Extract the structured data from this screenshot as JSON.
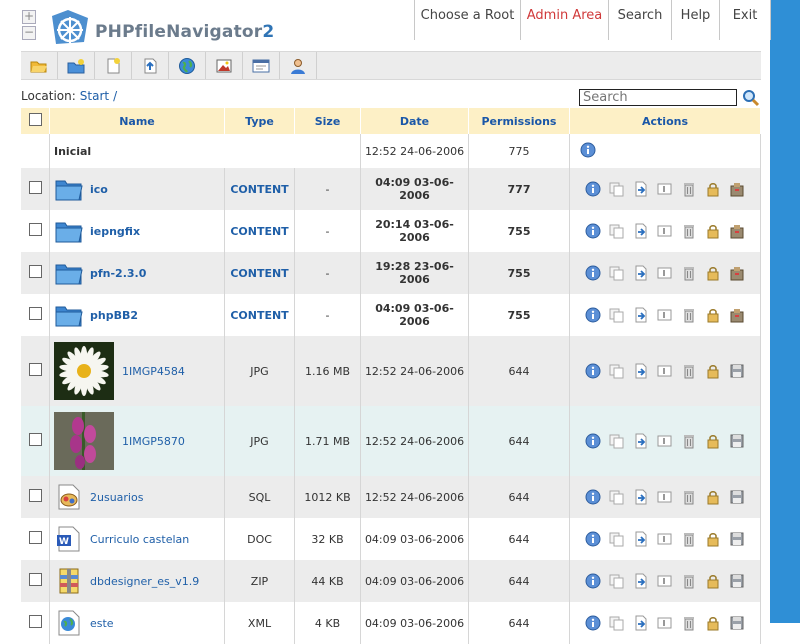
{
  "app": {
    "logo_text": "PHPfileNavigator",
    "logo_suffix": "2",
    "zoom_plus": "+",
    "zoom_minus": "−"
  },
  "nav": [
    {
      "label": "Choose a Root",
      "active": false
    },
    {
      "label": "Admin Area",
      "active": true
    },
    {
      "label": "Search",
      "active": false
    },
    {
      "label": "Help",
      "active": false
    },
    {
      "label": "Exit",
      "active": false
    }
  ],
  "toolbar": [
    "open-folder-icon",
    "new-folder-icon",
    "new-file-icon",
    "upload-icon",
    "web-icon",
    "image-icon",
    "window-icon",
    "user-icon"
  ],
  "location": {
    "label": "Location:",
    "crumb": "Start",
    "sep": "/"
  },
  "search": {
    "placeholder": "Search"
  },
  "table": {
    "headers": {
      "name": "Name",
      "type": "Type",
      "size": "Size",
      "date": "Date",
      "permissions": "Permissions",
      "actions": "Actions"
    },
    "parent": {
      "name": "Inicial",
      "date": "12:52 24-06-2006",
      "permissions": "775"
    },
    "rows": [
      {
        "name": "ico",
        "type": "CONTENT",
        "size": "-",
        "date": "04:09 03-06-2006",
        "permissions": "777",
        "kind": "folder"
      },
      {
        "name": "iepngfix",
        "type": "CONTENT",
        "size": "-",
        "date": "20:14 03-06-2006",
        "permissions": "755",
        "kind": "folder"
      },
      {
        "name": "pfn-2.3.0",
        "type": "CONTENT",
        "size": "-",
        "date": "19:28 23-06-2006",
        "permissions": "755",
        "kind": "folder"
      },
      {
        "name": "phpBB2",
        "type": "CONTENT",
        "size": "-",
        "date": "04:09 03-06-2006",
        "permissions": "755",
        "kind": "folder"
      },
      {
        "name": "1IMGP4584",
        "type": "JPG",
        "size": "1.16 MB",
        "date": "12:52 24-06-2006",
        "permissions": "644",
        "kind": "daisy"
      },
      {
        "name": "1IMGP5870",
        "type": "JPG",
        "size": "1.71 MB",
        "date": "12:52 24-06-2006",
        "permissions": "644",
        "kind": "flower"
      },
      {
        "name": "2usuarios",
        "type": "SQL",
        "size": "1012 KB",
        "date": "12:52 24-06-2006",
        "permissions": "644",
        "kind": "sql"
      },
      {
        "name": "Curriculo castelan",
        "type": "DOC",
        "size": "32 KB",
        "date": "04:09 03-06-2006",
        "permissions": "644",
        "kind": "doc"
      },
      {
        "name": "dbdesigner_es_v1.9",
        "type": "ZIP",
        "size": "44 KB",
        "date": "04:09 03-06-2006",
        "permissions": "644",
        "kind": "zip"
      },
      {
        "name": "este",
        "type": "XML",
        "size": "4 KB",
        "date": "04:09 03-06-2006",
        "permissions": "644",
        "kind": "xml"
      }
    ]
  }
}
